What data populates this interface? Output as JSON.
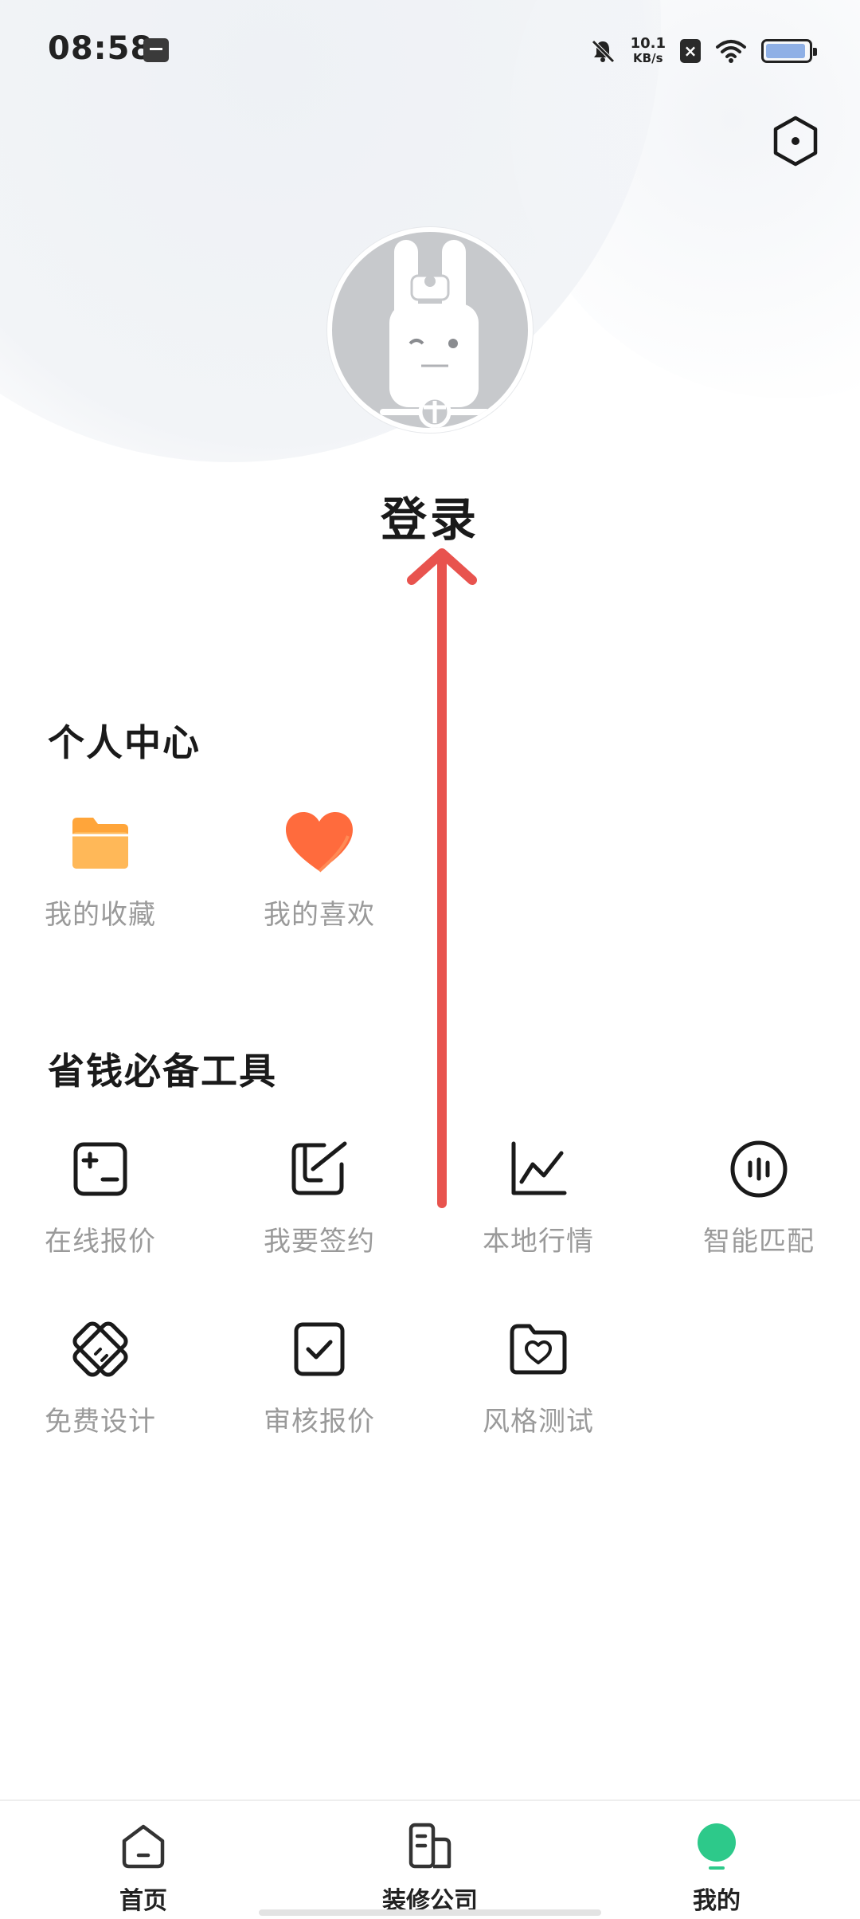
{
  "status_bar": {
    "time": "08:58",
    "net_speed_value": "10.1",
    "net_speed_unit": "KB/s",
    "battery_level": 0.95,
    "icons": [
      "notification-app-icon",
      "bell-muted-icon",
      "sim-x-icon",
      "wifi-icon",
      "battery-icon"
    ]
  },
  "header": {
    "settings_icon": "hexagon-settings-icon",
    "login_label": "登录"
  },
  "personal_center": {
    "title": "个人中心",
    "items": [
      {
        "label": "我的收藏",
        "icon": "folder-icon",
        "color": "#FFA53A"
      },
      {
        "label": "我的喜欢",
        "icon": "heart-icon",
        "color": "#FF6B3D"
      }
    ]
  },
  "tools": {
    "title": "省钱必备工具",
    "items": [
      {
        "label": "在线报价",
        "icon": "calculator-icon"
      },
      {
        "label": "我要签约",
        "icon": "sign-contract-icon"
      },
      {
        "label": "本地行情",
        "icon": "line-chart-icon"
      },
      {
        "label": "智能匹配",
        "icon": "voice-match-icon"
      },
      {
        "label": "免费设计",
        "icon": "ruler-design-icon"
      },
      {
        "label": "审核报价",
        "icon": "checkbox-icon"
      },
      {
        "label": "风格测试",
        "icon": "folder-heart-icon"
      }
    ]
  },
  "bottom_nav": {
    "items": [
      {
        "label": "首页",
        "icon": "home-icon",
        "active": false
      },
      {
        "label": "装修公司",
        "icon": "building-icon",
        "active": false
      },
      {
        "label": "我的",
        "icon": "profile-icon",
        "active": true
      }
    ],
    "active_color": "#2DC98A"
  },
  "annotation": {
    "arrow_color": "#E8534E"
  }
}
